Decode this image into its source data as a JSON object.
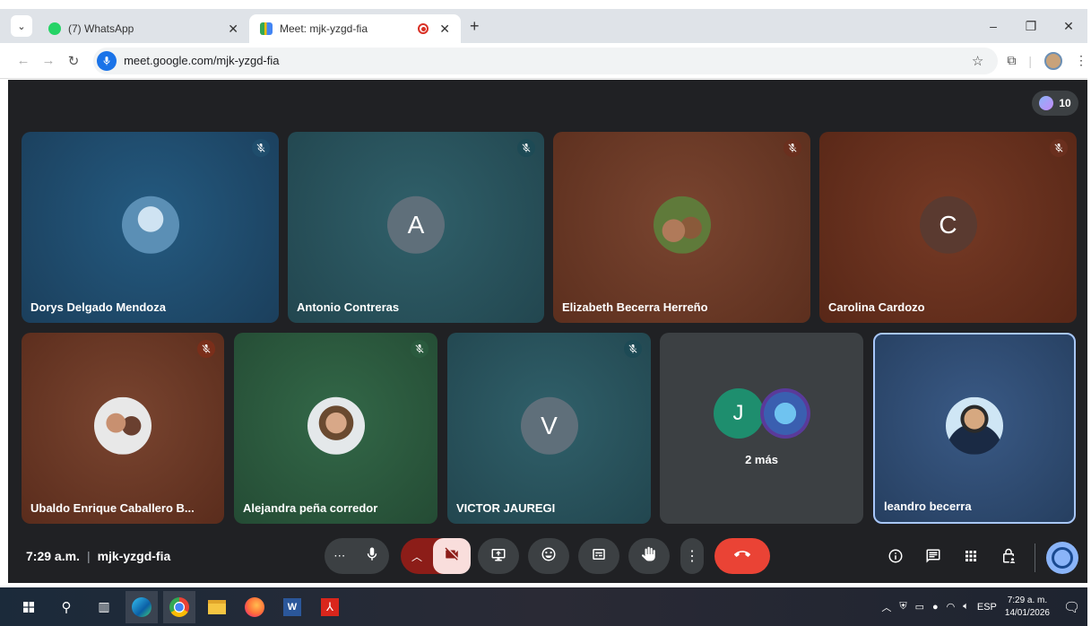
{
  "browser": {
    "tabs": [
      {
        "title": "(7) WhatsApp",
        "active": false,
        "favicon": "whatsapp-icon"
      },
      {
        "title": "Meet: mjk-yzgd-fia",
        "active": true,
        "favicon": "meet-icon",
        "recording": true
      }
    ],
    "url": "meet.google.com/mjk-yzgd-fia"
  },
  "meet": {
    "participant_count": "10",
    "time": "7:29 a.m.",
    "meeting_code": "mjk-yzgd-fia",
    "tiles": [
      {
        "name": "Dorys Delgado Mendoza",
        "avatar_type": "photo",
        "bg": "#1e4c6e",
        "muted": true,
        "mute_color": "#1f4d6c"
      },
      {
        "name": "Antonio Contreras",
        "avatar_type": "letter",
        "letter": "A",
        "bg": "#2a4f56",
        "muted": true,
        "mute_color": "#244c56"
      },
      {
        "name": "Elizabeth Becerra Herreño",
        "avatar_type": "photo",
        "bg": "#6d3a25",
        "muted": true,
        "mute_color": "#6a2f1e"
      },
      {
        "name": "Carolina Cardozo",
        "avatar_type": "letter",
        "letter": "C",
        "bg": "#6a3020",
        "muted": true,
        "mute_color": "#6a2f1e"
      },
      {
        "name": "Ubaldo Enrique Caballero B...",
        "avatar_type": "photo",
        "bg": "#6b3a26",
        "muted": true,
        "mute_color": "#7a2e1a"
      },
      {
        "name": "Alejandra peña corredor",
        "avatar_type": "photo",
        "bg": "#2d5a44",
        "muted": true,
        "mute_color": "#2a5a3e"
      },
      {
        "name": "VICTOR JAUREGI",
        "avatar_type": "letter",
        "letter": "V",
        "bg": "#2a4f56",
        "muted": true,
        "mute_color": "#244c56"
      },
      {
        "name": "leandro becerra",
        "avatar_type": "photo",
        "bg": "#2f4a6e",
        "muted": false,
        "highlighted": true
      }
    ],
    "others_tile": {
      "letter": "J",
      "label": "2 más"
    }
  },
  "taskbar": {
    "time": "7:29 a. m.",
    "date": "14/01/2026",
    "language": "ESP"
  }
}
